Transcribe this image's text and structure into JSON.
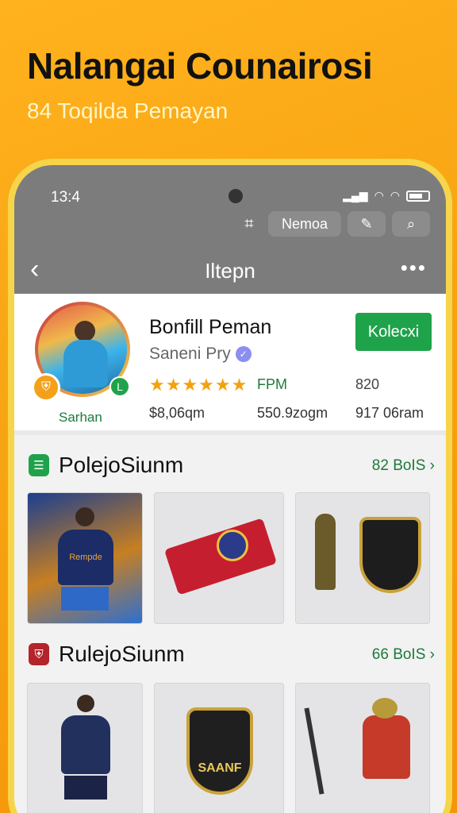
{
  "promo": {
    "title": "Nalangai Counairosi",
    "subtitle": "84 Toqilda Pemayan"
  },
  "status_bar": {
    "time": "13:4"
  },
  "toolbar": {
    "menu_label": "Nemoa"
  },
  "nav": {
    "title": "Iltepn"
  },
  "profile": {
    "name": "Bonfill Peman",
    "subtitle": "Saneni Pry",
    "follow_label": "Kolecxi",
    "avatar_caption": "Sarhan",
    "rating_stars": 5,
    "stars_text": "★★★★★★",
    "stat_labels": [
      "FPM",
      "820"
    ],
    "stat_values": [
      "$8,06qm",
      "550.9zogm",
      "917 06ram"
    ]
  },
  "sections": [
    {
      "title": "PolejoSiunm",
      "link": "82 BoIS ›",
      "icon_color": "#1fa34a"
    },
    {
      "title": "RulejoSiunm",
      "link": "66 BoIS ›",
      "icon_color": "#b3242b"
    }
  ],
  "tile_labels": {
    "badge_text": "SAANF",
    "jersey_text": "Rempde"
  }
}
